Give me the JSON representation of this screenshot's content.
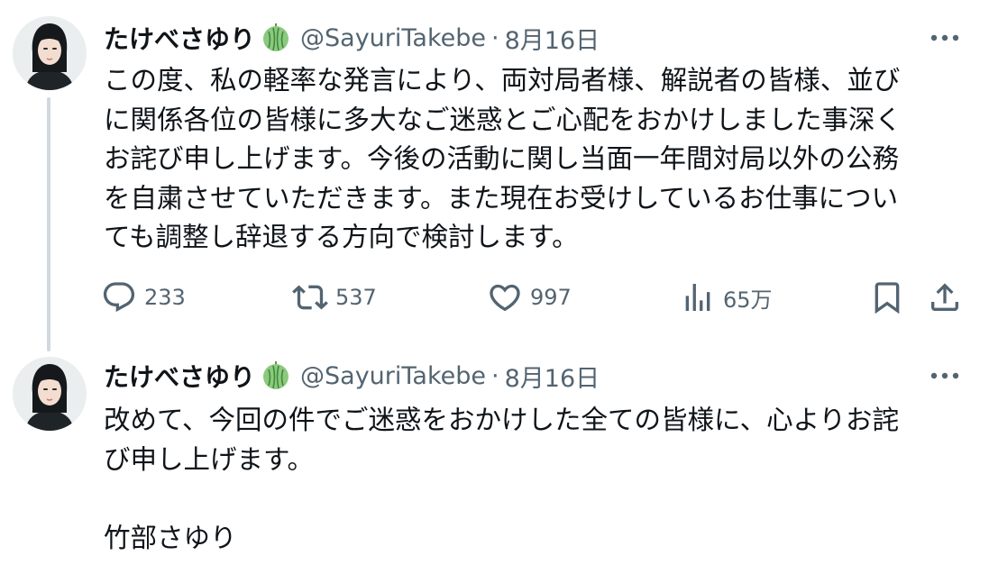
{
  "thread": [
    {
      "author": {
        "name": "たけべさゆり",
        "handle": "@SayuriTakebe",
        "separator": "·",
        "date": "8月16日"
      },
      "badge_icon": "melon-icon",
      "text": "この度、私の軽率な発言により、両対局者様、解説者の皆様、並び\nに関係各位の皆様に多大なご迷惑とご心配をおかけしました事深く\nお詫び申し上げます。今後の活動に関し当面一年間対局以外の公務\nを自粛させていただきます。また現在お受けしているお仕事につい\nても調整し辞退する方向で検討します。",
      "stats": {
        "replies": "233",
        "reposts": "537",
        "likes": "997",
        "views": "65万"
      }
    },
    {
      "author": {
        "name": "たけべさゆり",
        "handle": "@SayuriTakebe",
        "separator": "·",
        "date": "8月16日"
      },
      "badge_icon": "melon-icon",
      "text": "改めて、今回の件でご迷惑をおかけした全ての皆様に、心よりお詫\nび申し上げます。\n\n竹部さゆり"
    }
  ],
  "icons": {
    "reply": "reply-icon",
    "repost": "repost-icon",
    "like": "heart-icon",
    "views": "views-icon",
    "bookmark": "bookmark-icon",
    "share": "share-icon",
    "more": "more-icon"
  },
  "colors": {
    "text": "#0f1419",
    "secondary": "#536471",
    "thread_line": "#cfd9de",
    "badge": "#7fc07a"
  }
}
